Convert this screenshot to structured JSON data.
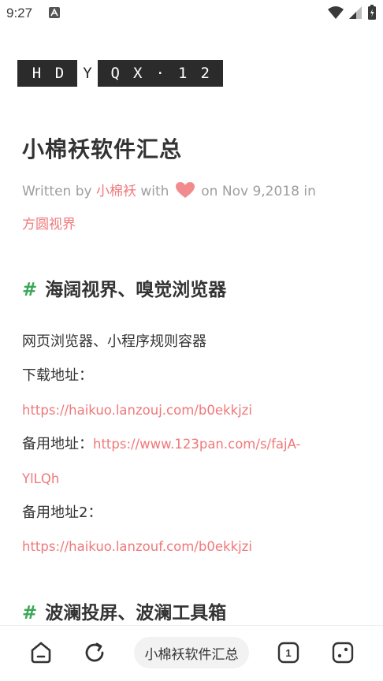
{
  "status_bar": {
    "time": "9:27",
    "icons": [
      "app-notification-icon",
      "wifi-icon",
      "signal-icon",
      "battery-icon"
    ]
  },
  "logo": {
    "part1": "HD",
    "part2": "Y",
    "part3": "QX·12"
  },
  "article": {
    "title": "小棉袄软件汇总",
    "meta": {
      "written_by": "Written by",
      "author": "小棉袄",
      "with": "with",
      "on": "on",
      "date": "Nov 9,2018",
      "in": "in",
      "category": "方圆视界"
    }
  },
  "sections": [
    {
      "hash": "#",
      "heading": "海阔视界、嗅觉浏览器",
      "description": "网页浏览器、小程序规则容器",
      "download_label": "下载地址：",
      "download_url": "https://haikuo.lanzouj.com/b0ekkjzi",
      "backup_label": "备用地址：",
      "backup_url_part1": "https://www.123pan.com/s/fajA-",
      "backup_url_part2": "YlLQh",
      "backup2_label": "备用地址2：",
      "backup2_url": "https://haikuo.lanzouf.com/b0ekkjzi"
    },
    {
      "hash": "#",
      "heading": "波澜投屏、波澜工具箱"
    }
  ],
  "bottom_nav": {
    "page_title": "小棉袄软件汇总",
    "tab_count": "1"
  },
  "colors": {
    "accent_pink": "#f0787a",
    "hash_green": "#3aa757",
    "text": "#333333",
    "meta_gray": "#9e9e9e"
  }
}
